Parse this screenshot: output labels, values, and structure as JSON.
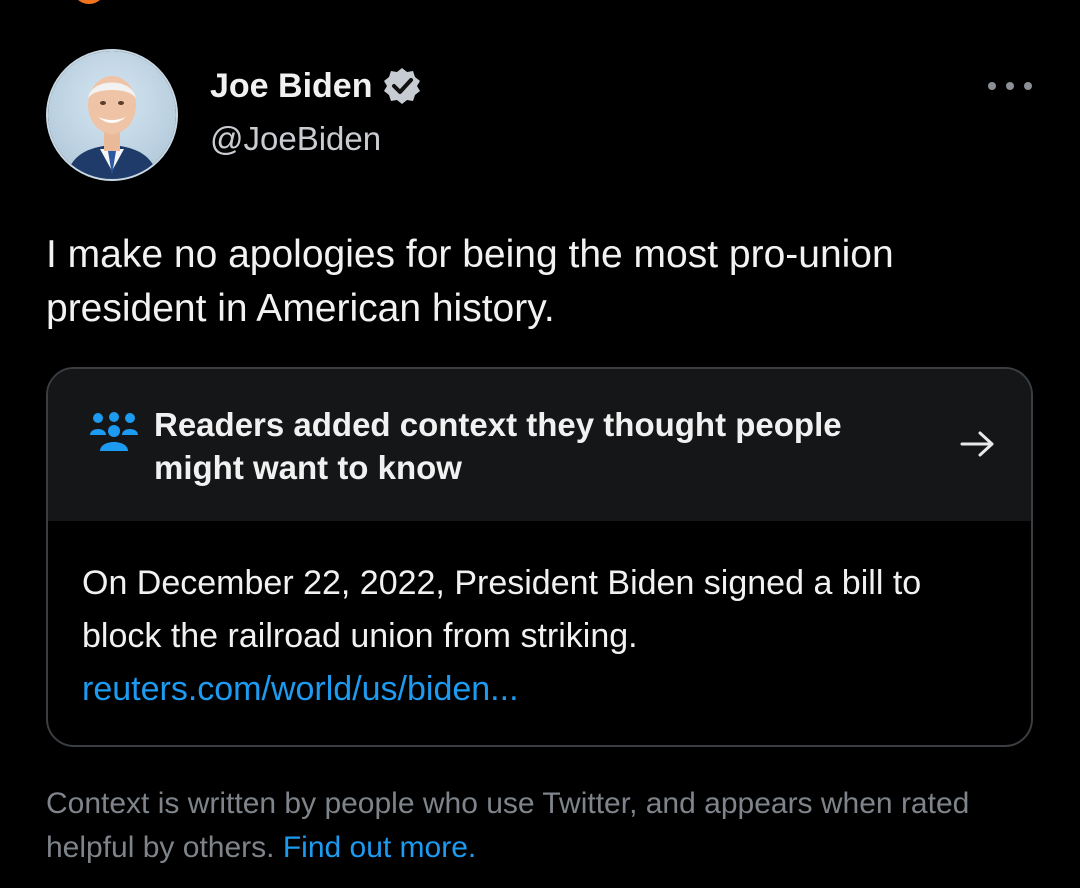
{
  "tweet": {
    "author": {
      "display_name": "Joe Biden",
      "handle": "@JoeBiden"
    },
    "text": "I make no apologies for being the most pro-union president in American history."
  },
  "note": {
    "title": "Readers added context they thought people might want to know",
    "body": "On December 22, 2022, President Biden signed a bill to block the railroad union from striking.",
    "link": "reuters.com/world/us/biden..."
  },
  "footer": {
    "text": "Context is written by people who use Twitter, and appears when rated helpful by others.",
    "link": "Find out more."
  },
  "icons": {
    "verified": "verified-badge-icon",
    "more": "more-options-icon",
    "readers": "readers-icon",
    "arrow": "arrow-right-icon"
  },
  "colors": {
    "background": "#000000",
    "link_blue": "#1d9bf0",
    "note_header_bg": "#141618",
    "muted_text": "#7e848a"
  }
}
